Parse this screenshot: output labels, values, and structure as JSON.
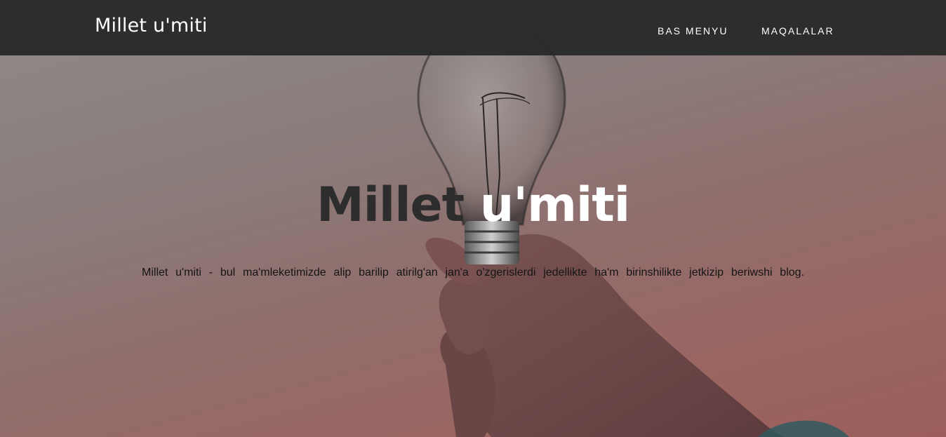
{
  "header": {
    "brand": "Millet u'miti",
    "nav": [
      {
        "label": "BAS MENYU"
      },
      {
        "label": "MAQALALAR"
      }
    ]
  },
  "hero": {
    "title_dark": "Millet",
    "title_light": "u'miti",
    "subtitle": "Millet u'miti - bul ma'mleketimizde alip barilip atirilg'an jan'a o'zgerislerdi jedellikte ha'm birinshilikte jetkizip beriwshi blog."
  },
  "colors": {
    "navbar": "#292a2a",
    "title_dark": "#2d2d2d",
    "title_light": "#ffffff"
  }
}
